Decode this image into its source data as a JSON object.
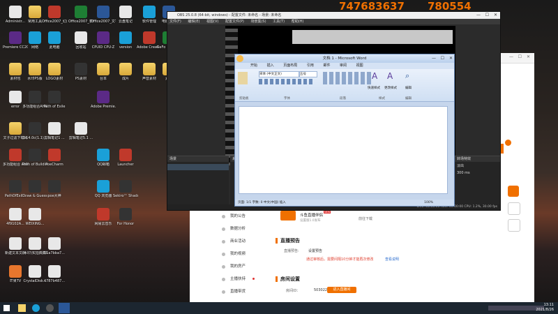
{
  "overlay": {
    "left_num": "747683637",
    "right_num": "780554"
  },
  "desktop_icons": [
    {
      "label": "Administr...",
      "cls": "app-white"
    },
    {
      "label": "常用工具",
      "cls": "folder"
    },
    {
      "label": "Office2007_幻灯片PPT",
      "cls": "app-red"
    },
    {
      "label": "Office2007_表格",
      "cls": "app-green"
    },
    {
      "label": "Office2007_文字",
      "cls": "app-blue"
    },
    {
      "label": "云盘笔记",
      "cls": "app-white"
    },
    {
      "label": "软件管理",
      "cls": "app-cyan"
    },
    {
      "label": "电脑管家",
      "cls": "app-blue"
    },
    {
      "label": "Premiere CC2019",
      "cls": "app-purple"
    },
    {
      "label": "网络",
      "cls": "app-cyan"
    },
    {
      "label": "此电脑",
      "cls": "app-cyan"
    },
    {
      "label": "回收站",
      "cls": "app-white"
    },
    {
      "label": "CPUID CPU-Z",
      "cls": "app-purple"
    },
    {
      "label": "version",
      "cls": "app-cyan"
    },
    {
      "label": "Adobe Creati...",
      "cls": "app-red"
    },
    {
      "label": "GeFo Experi...",
      "cls": "app-green"
    },
    {
      "label": "素材包",
      "cls": "folder"
    },
    {
      "label": "水印PS版",
      "cls": "folder"
    },
    {
      "label": "LOGO素材",
      "cls": "folder"
    },
    {
      "label": "PS素材",
      "cls": "app-dark"
    },
    {
      "label": "台本",
      "cls": "folder"
    },
    {
      "label": "成片",
      "cls": "folder"
    },
    {
      "label": "声音素材",
      "cls": "folder"
    },
    {
      "label": "素材",
      "cls": "folder"
    },
    {
      "label": "error",
      "cls": "app-white"
    },
    {
      "label": "多功能组合AHK",
      "cls": "app-dark"
    },
    {
      "label": "Path of Exile",
      "cls": "app-dark"
    },
    {
      "label": "Adobe Premie...",
      "cls": "app-purple"
    },
    {
      "label": "文子过滤下载网",
      "cls": "folder"
    },
    {
      "label": "3.14.0c(1.1)...",
      "cls": "app-dark"
    },
    {
      "label": "剪辑笔记1 ...",
      "cls": "app-white"
    },
    {
      "label": "剪辑笔记5.1 ...",
      "cls": "app-white"
    },
    {
      "label": "多功能组合 AHK20.19...",
      "cls": "app-red"
    },
    {
      "label": "Path of Building",
      "cls": "app-dark"
    },
    {
      "label": "PoeCharm",
      "cls": "app-red"
    },
    {
      "label": "QQ邮箱",
      "cls": "app-cyan"
    },
    {
      "label": "Launcher",
      "cls": "app-red"
    },
    {
      "label": "PathOfExil...",
      "cls": "app-dark"
    },
    {
      "label": "Draw & Guess",
      "cls": "app-dark"
    },
    {
      "label": "poe大神",
      "cls": "app-dark"
    },
    {
      "label": "QQ 浏览器",
      "cls": "app-cyan"
    },
    {
      "label": "Sekiro™ Shadow...",
      "cls": "app-dark"
    },
    {
      "label": "4f9102A...",
      "cls": "app-white"
    },
    {
      "label": "WEIXING...",
      "cls": "app-white"
    },
    {
      "label": "网易云音乐",
      "cls": "app-red"
    },
    {
      "label": "For Honor",
      "cls": "app-dark"
    },
    {
      "label": "新建文本文档",
      "cls": "app-white"
    },
    {
      "label": "(水印)实拍典藏珍藏",
      "cls": "app-white"
    },
    {
      "label": "51a7bba7...",
      "cls": "app-white"
    },
    {
      "label": "芒果TV",
      "cls": "app-orange"
    },
    {
      "label": "CrystalDisk...",
      "cls": "app-white"
    },
    {
      "label": "4787b487...",
      "cls": "app-white"
    }
  ],
  "browser": {
    "banner_title": "斗鱼直播伴侣",
    "banner_sub": "设置版1.0发布",
    "banner_new": "NEW",
    "banner_link": "前往下载",
    "menu": [
      "我的公告",
      "数据分析",
      "商业活动",
      "我的视频",
      "我的房产",
      "主播扶持",
      "直播带货"
    ],
    "sec1": "直播预告",
    "preview_label": "直播预告:",
    "preview_value": "设置预告",
    "warn_text": "通过审核后，需要间隔10分钟才能再次修改",
    "warn_link": "查看说明",
    "sec2": "房间设置",
    "room_label": "房间ID：",
    "room_id": "5030221",
    "room_btn": "进入直播间"
  },
  "obs": {
    "title": "OBS 25.0.8 (64-bit, windows) - 配置文件: 未命名 - 场景: 未命名",
    "menu": [
      "文件(F)",
      "编辑(E)",
      "视图(V)",
      "配置文件(P)",
      "场景集(S)",
      "工具(T)",
      "帮助(H)"
    ],
    "dock_scene": "场景",
    "dock_source": "来源",
    "dock_trans": "转场特效",
    "dock_trans_val": "淡出",
    "dock_dur": "300 ms",
    "status": "LIVE: 00:00:00  REC: 00:00:00  CPU: 1.2%, 30.00 fps"
  },
  "word": {
    "title": "文档 1 - Microsoft Word",
    "tabs": [
      "开始",
      "插入",
      "页面布局",
      "引用",
      "邮件",
      "审阅",
      "视图"
    ],
    "groups": [
      "剪贴板",
      "字体",
      "段落",
      "样式",
      "编辑"
    ],
    "font": "宋体 (中文正文)",
    "size": "五号",
    "style1": "快速样式",
    "style2": "更改样式",
    "edit": "编辑",
    "status": "页面: 1/1  字数: 0  中文(中国)  插入",
    "zoom": "100%"
  },
  "taskbar": {
    "time": "13:11",
    "date": "2021/8/26"
  }
}
